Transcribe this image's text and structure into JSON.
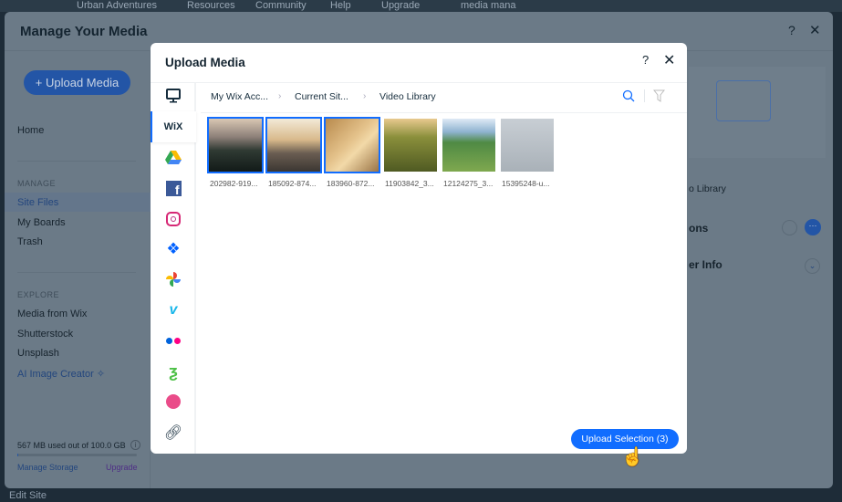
{
  "topnav": {
    "items": [
      "Urban Adventures",
      "Resources",
      "Community",
      "Help",
      "Upgrade"
    ],
    "search": "media mana"
  },
  "outer": {
    "title": "Manage Your Media",
    "help": "?",
    "close": "✕",
    "upload_button": "+ Upload Media",
    "nav": {
      "home": "Home",
      "manage_header": "MANAGE",
      "manage": [
        "Site Files",
        "My Boards",
        "Trash"
      ],
      "explore_header": "EXPLORE",
      "explore": [
        "Media from Wix",
        "Shutterstock",
        "Unsplash",
        "AI Image Creator"
      ]
    },
    "storage": {
      "text": "567 MB used out of 100.0 GB",
      "used_fraction": 0.0057,
      "manage": "Manage Storage",
      "upgrade": "Upgrade"
    },
    "right": {
      "library": "o Library",
      "actions": "ons",
      "info": "er Info"
    },
    "edit_site": "Edit Site"
  },
  "modal": {
    "title": "Upload Media",
    "help": "?",
    "close": "✕",
    "sources": [
      "computer-icon",
      "wix-logo",
      "google-drive-icon",
      "facebook-icon",
      "instagram-icon",
      "dropbox-icon",
      "google-photos-icon",
      "vimeo-icon",
      "flickr-icon",
      "deviantart-icon",
      "dribbble-icon",
      "link-icon"
    ],
    "wix_label": "WiX",
    "breadcrumb": [
      "My Wix Acc...",
      "Current Sit...",
      "Video Library"
    ],
    "files": [
      {
        "name": "202982-919...",
        "selected": true
      },
      {
        "name": "185092-874...",
        "selected": true
      },
      {
        "name": "183960-872...",
        "selected": true
      },
      {
        "name": "11903842_3...",
        "selected": false
      },
      {
        "name": "12124275_3...",
        "selected": false
      },
      {
        "name": "15395248-u...",
        "selected": false
      }
    ],
    "upload_button": "Upload Selection (3)"
  },
  "colors": {
    "accent": "#116dff"
  }
}
